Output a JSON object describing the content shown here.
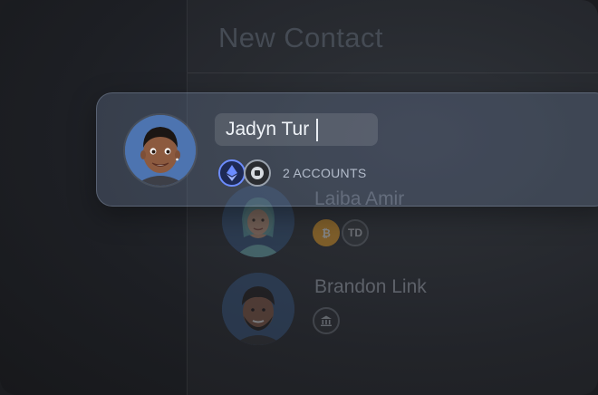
{
  "panel": {
    "title": "New Contact"
  },
  "selected_contact": {
    "name_value": "Jadyn Tur",
    "accounts_label": "2 ACCOUNTS",
    "badges": [
      {
        "icon": "ethereum-icon",
        "color": "#6c8cff"
      },
      {
        "icon": "coinbase-icon",
        "color": "#9aa2ad"
      }
    ]
  },
  "contacts": [
    {
      "name": "Laiba Amir",
      "badges": [
        {
          "icon": "bitcoin-icon",
          "color": "#f5a623"
        },
        {
          "icon": "td-icon",
          "label": "TD",
          "color": "#8b929b"
        }
      ]
    },
    {
      "name": "Brandon Link",
      "badges": [
        {
          "icon": "bank-icon",
          "color": "#8b929b"
        }
      ]
    }
  ]
}
